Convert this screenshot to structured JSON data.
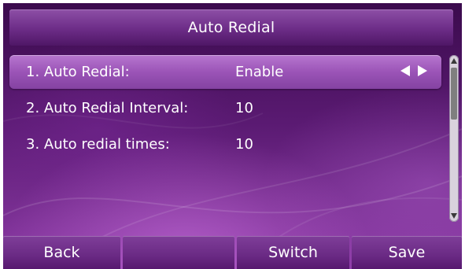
{
  "title": "Auto Redial",
  "items": [
    {
      "label": "1. Auto Redial:",
      "value": "Enable"
    },
    {
      "label": "2. Auto Redial Interval:",
      "value": "10"
    },
    {
      "label": "3. Auto redial times:",
      "value": "10"
    }
  ],
  "softkeys": [
    "Back",
    "",
    "Switch",
    "Save"
  ],
  "colors": {
    "background": "#5a1a72",
    "title_bar": "#6c2c87",
    "selected_row": "#9b54b7",
    "text": "#ffffff"
  }
}
